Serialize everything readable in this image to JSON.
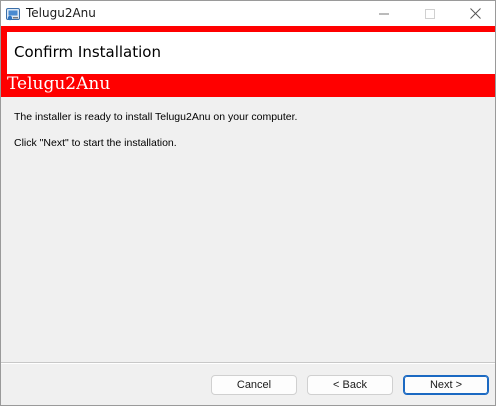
{
  "window": {
    "title": "Telugu2Anu",
    "icon": "installer-icon"
  },
  "controls": {
    "minimize_icon": "minimize-icon",
    "maximize_icon": "maximize-icon",
    "close_icon": "close-icon"
  },
  "header": {
    "title": "Confirm Installation",
    "product": "Telugu2Anu",
    "accent_color": "#ff0000"
  },
  "body": {
    "line1": "The installer is ready to install Telugu2Anu on your computer.",
    "line2": "Click \"Next\" to start the installation."
  },
  "buttons": {
    "cancel": "Cancel",
    "back": "< Back",
    "next": "Next >"
  }
}
